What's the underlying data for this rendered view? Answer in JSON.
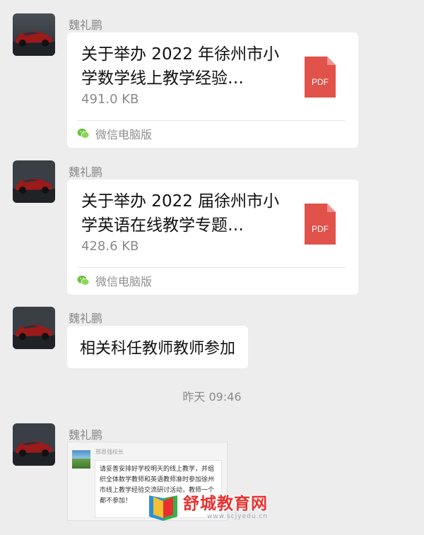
{
  "messages": [
    {
      "sender": "魏礼鹏",
      "type": "file",
      "title": "关于举办 2022 年徐州市小学数学线上教学经验…",
      "size": "491.0 KB",
      "source": "微信电脑版",
      "file_type": "PDF"
    },
    {
      "sender": "魏礼鹏",
      "type": "file",
      "title": "关于举办 2022 届徐州市小学英语在线教学专题…",
      "size": "428.6 KB",
      "source": "微信电脑版",
      "file_type": "PDF"
    },
    {
      "sender": "魏礼鹏",
      "type": "text",
      "text": "相关科任教师教师参加"
    },
    {
      "sender": "魏礼鹏",
      "type": "image",
      "inner_sender": "邢恩强校长",
      "inner_text": "请妥善安排好学校明天的线上教学，并组织全体数学教师和英语教师准时参加徐州市线上教学经验交流研讨活动，教师一个都不参加！"
    }
  ],
  "timestamp": "昨天 09:46",
  "watermark": {
    "text": "舒城教育网",
    "url": "www.scjyedu.cn"
  },
  "colors": {
    "background": "#ededed",
    "bubble": "#ffffff",
    "pdf_red": "#e0524a",
    "watermark_red": "#e8312f"
  },
  "icons": [
    "car-avatar",
    "pdf-file-icon",
    "wechat-icon"
  ]
}
